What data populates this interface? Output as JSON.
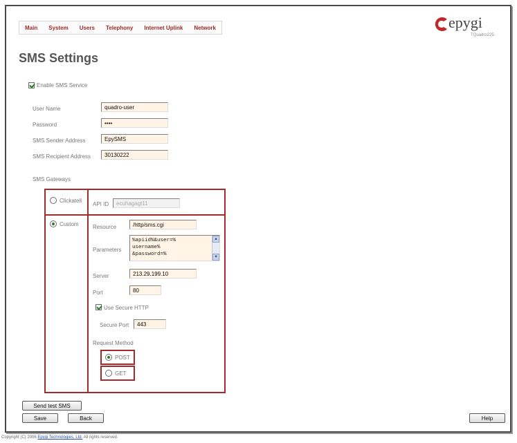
{
  "nav": {
    "items": [
      "Main",
      "System",
      "Users",
      "Telephony",
      "Internet Uplink",
      "Network"
    ]
  },
  "brand": {
    "name": "epygi",
    "model": "TQuadro225"
  },
  "page_title": "SMS Settings",
  "enable_sms": {
    "label": "Enable SMS Service",
    "checked": true
  },
  "fields": {
    "user_name": {
      "label": "User Name",
      "value": "quadro-user"
    },
    "password": {
      "label": "Password",
      "value": "••••"
    },
    "sender": {
      "label": "SMS Sender Address",
      "value": "EpySMS"
    },
    "recipient": {
      "label": "SMS Recipient Address",
      "value": "30130222"
    }
  },
  "gateways": {
    "label": "SMS Gateways",
    "clickatell": {
      "label": "Clickatell",
      "selected": false,
      "api_label": "API ID",
      "api_value": "ecuhagagt11"
    },
    "custom": {
      "label": "Custom",
      "selected": true,
      "resource_label": "Resource",
      "resource_value": "/http/sms.cgi",
      "parameters_label": "Parameters",
      "parameters_lines": [
        "%apiid%&user=%",
        "username%",
        "&password=%"
      ],
      "server_label": "Server",
      "server_value": "213.29.199.10",
      "port_label": "Port",
      "port_value": "80",
      "secure_http_label": "Use Secure HTTP",
      "secure_http_checked": true,
      "secure_port_label": "Secure Port",
      "secure_port_value": "443",
      "request_method_label": "Request Method",
      "post_label": "POST",
      "get_label": "GET",
      "method": "POST"
    }
  },
  "buttons": {
    "send_test": "Send test SMS",
    "save": "Save",
    "back": "Back",
    "help": "Help"
  },
  "footer": {
    "prefix": "Copyright (C) 2006 ",
    "company": "Epygi Technologies, Ltd.",
    "suffix": " All rights reserved."
  },
  "colors": {
    "nav_text": "#a02828",
    "frame_red": "#a22a2a",
    "input_bg": "#fff4e6",
    "check_green": "#2a7a2a",
    "logo_red": "#c0282d"
  }
}
